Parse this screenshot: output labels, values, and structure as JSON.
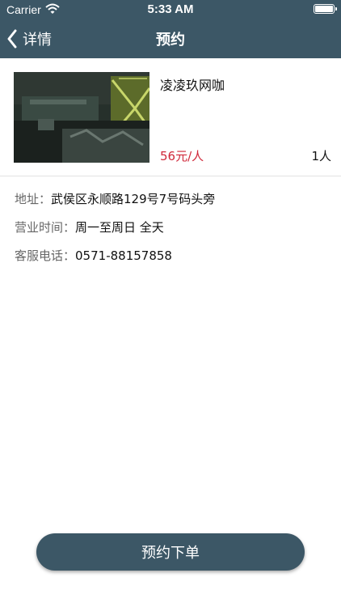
{
  "status_bar": {
    "carrier": "Carrier",
    "time": "5:33 AM"
  },
  "nav": {
    "back_label": "详情",
    "title": "预约"
  },
  "store": {
    "name": "凌凌玖网咖",
    "price": "56元/人",
    "count": "1人"
  },
  "info": {
    "address_label": "地址：",
    "address_value": "武侯区永顺路129号7号码头旁",
    "hours_label": "营业时间：",
    "hours_value": "周一至周日 全天",
    "phone_label": "客服电话：",
    "phone_value": "0571-88157858"
  },
  "actions": {
    "book_label": "预约下单"
  },
  "colors": {
    "header": "#3c5766",
    "price": "#d0283a",
    "button": "#3c5766"
  }
}
